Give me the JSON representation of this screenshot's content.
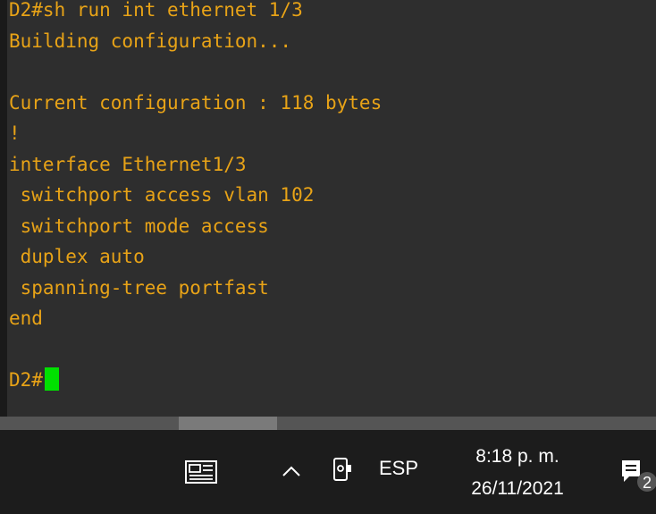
{
  "terminal": {
    "lines": [
      "D2#sh run int ethernet 1/3",
      "Building configuration...",
      "",
      "Current configuration : 118 bytes",
      "!",
      "interface Ethernet1/3",
      " switchport access vlan 102",
      " switchport mode access",
      " duplex auto",
      " spanning-tree portfast",
      "end",
      "",
      "D2#"
    ],
    "text_color": "#e8a317",
    "cursor_color": "#00e000"
  },
  "taskbar": {
    "icons": [
      "news-icon",
      "chevron-up-icon",
      "camera-icon",
      "notification-icon"
    ],
    "language": "ESP",
    "time": "8:18 p. m.",
    "date": "26/11/2021",
    "notification_count": "2"
  }
}
